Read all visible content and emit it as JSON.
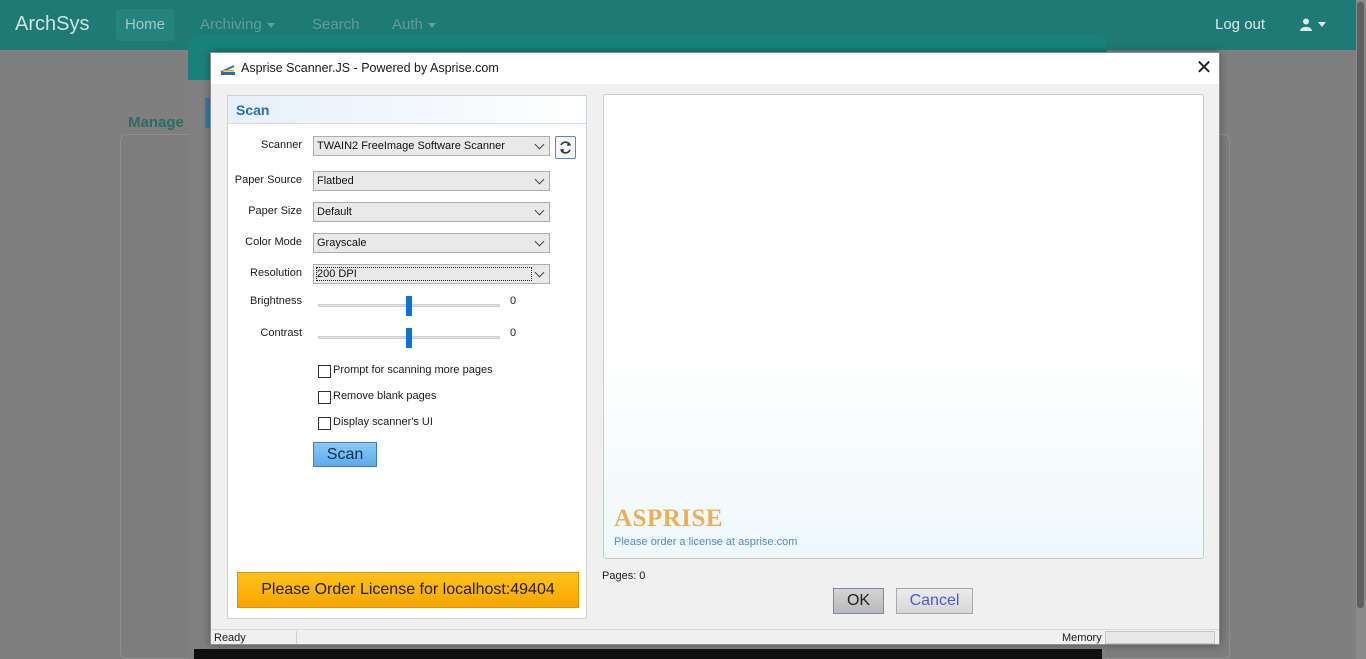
{
  "background": {
    "brand": "ArchSys",
    "nav": {
      "home": "Home",
      "archiving": "Archiving",
      "search": "Search",
      "auth": "Auth"
    },
    "logout": "Log out",
    "manage": "Manage"
  },
  "dialog": {
    "title": "Asprise Scanner.JS - Powered by Asprise.com",
    "close_glyph": "✕",
    "panel_title": "Scan",
    "fields": {
      "scanner": {
        "label": "Scanner",
        "value": "TWAIN2 FreeImage Software Scanner"
      },
      "paper_source": {
        "label": "Paper Source",
        "value": "Flatbed"
      },
      "paper_size": {
        "label": "Paper Size",
        "value": "Default"
      },
      "color_mode": {
        "label": "Color Mode",
        "value": "Grayscale"
      },
      "resolution": {
        "label": "Resolution",
        "value": "200 DPI"
      },
      "brightness": {
        "label": "Brightness",
        "value": "0",
        "level": 0.5
      },
      "contrast": {
        "label": "Contrast",
        "value": "0",
        "level": 0.5
      }
    },
    "options": {
      "prompt_more_pages": {
        "label": "Prompt for scanning more pages",
        "checked": false
      },
      "remove_blank_pages": {
        "label": "Remove blank pages",
        "checked": false
      },
      "display_scanner_ui": {
        "label": "Display scanner's UI",
        "checked": false
      }
    },
    "scan_button": "Scan",
    "license_button": "Please Order License for localhost:49404",
    "preview": {
      "logo": "ASPRISE",
      "note": "Please order a license at asprise.com"
    },
    "pages_label": "Pages: 0",
    "ok_button": "OK",
    "cancel_button": "Cancel",
    "status": {
      "ready": "Ready",
      "memory_label": "Memory"
    }
  },
  "colors": {
    "nav_bg": "#1e7a74",
    "accent_blue": "#2a6fb6",
    "license_orange": "#ffc21a",
    "slider_thumb": "#0a74d9",
    "asprise_logo": "#f0ae55"
  },
  "icons": {
    "title": "scanner-icon",
    "refresh": "refresh-icon",
    "user": "user-icon"
  }
}
